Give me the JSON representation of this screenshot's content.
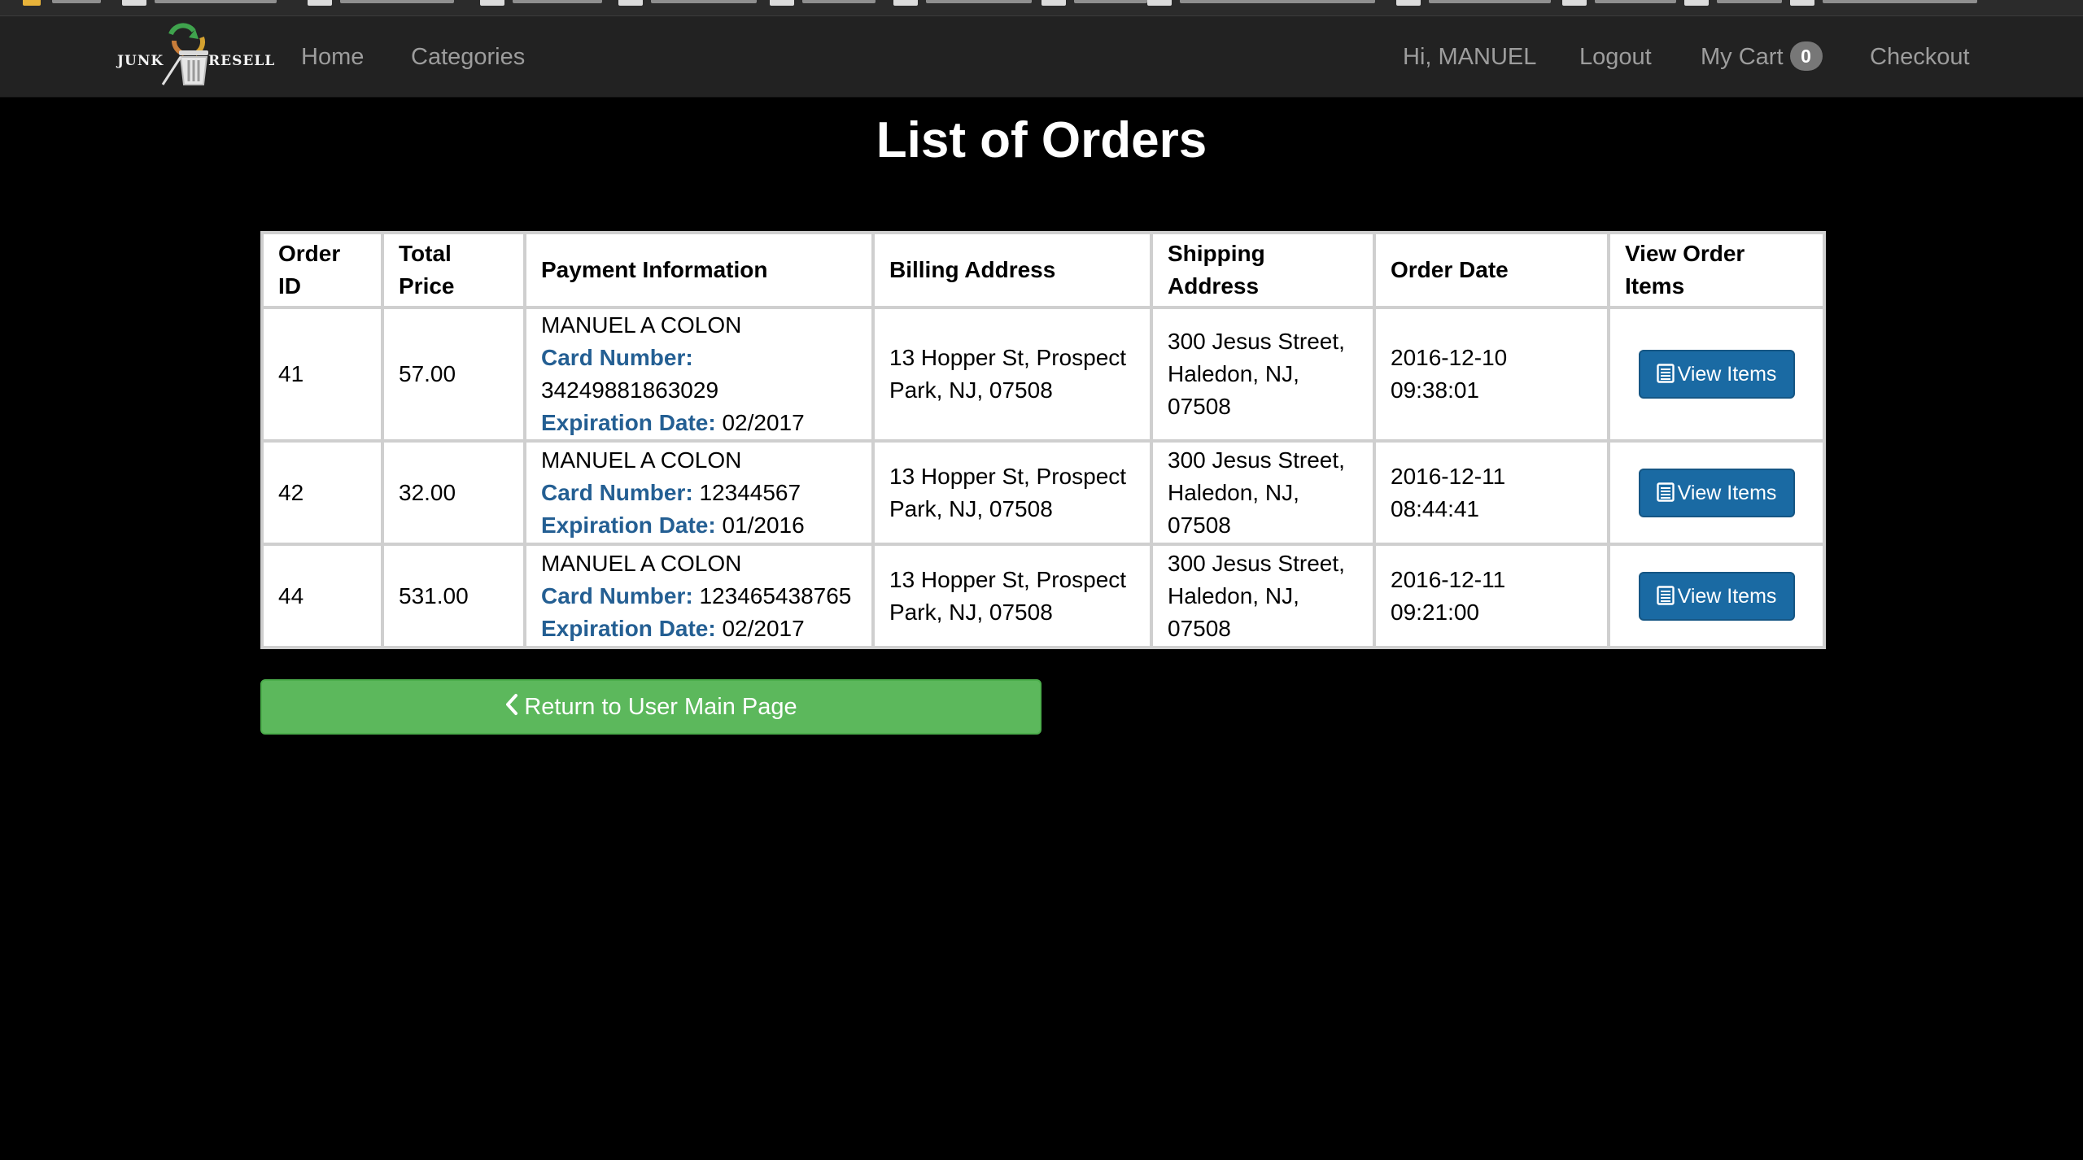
{
  "navbar": {
    "brand": {
      "logo_text_left": "JUNK",
      "logo_text_right": "RESELL"
    },
    "links": {
      "home": "Home",
      "categories": "Categories"
    },
    "right": {
      "greeting": "Hi, MANUEL",
      "logout": "Logout",
      "cart_label": "My Cart",
      "cart_count": "0",
      "checkout": "Checkout"
    }
  },
  "page": {
    "title": "List of Orders"
  },
  "table": {
    "headers": {
      "order_id": "Order ID",
      "total_price": "Total Price",
      "payment": "Payment Information",
      "billing": "Billing Address",
      "shipping": "Shipping Address",
      "order_date": "Order Date",
      "view_items": "View Order Items"
    },
    "card_number_label": "Card Number:",
    "expiration_label": "Expiration Date:",
    "rows": [
      {
        "id": "41",
        "total": "57.00",
        "name": "MANUEL A COLON",
        "card": "34249881863029",
        "expiration": "02/2017",
        "billing": "13 Hopper St, Prospect Park, NJ, 07508",
        "shipping": "300 Jesus Street, Haledon, NJ, 07508",
        "date": "2016-12-10 09:38:01",
        "button": "View Items"
      },
      {
        "id": "42",
        "total": "32.00",
        "name": "MANUEL A COLON",
        "card": "12344567",
        "expiration": "01/2016",
        "billing": "13 Hopper St, Prospect Park, NJ, 07508",
        "shipping": "300 Jesus Street, Haledon, NJ, 07508",
        "date": "2016-12-11 08:44:41",
        "button": "View Items"
      },
      {
        "id": "44",
        "total": "531.00",
        "name": "MANUEL A COLON",
        "card": "123465438765",
        "expiration": "02/2017",
        "billing": "13 Hopper St, Prospect Park, NJ, 07508",
        "shipping": "300 Jesus Street, Haledon, NJ, 07508",
        "date": "2016-12-11 09:21:00",
        "button": "View Items"
      }
    ]
  },
  "return_button": {
    "label": "Return to User Main Page",
    "icon": "chevron-left-icon"
  },
  "colors": {
    "navbar_bg": "#222222",
    "nav_link": "#9d9d9d",
    "label_blue": "#245f93",
    "primary_button": "#1a6aa3",
    "success_button": "#5cb85c",
    "page_bg": "#000000"
  }
}
